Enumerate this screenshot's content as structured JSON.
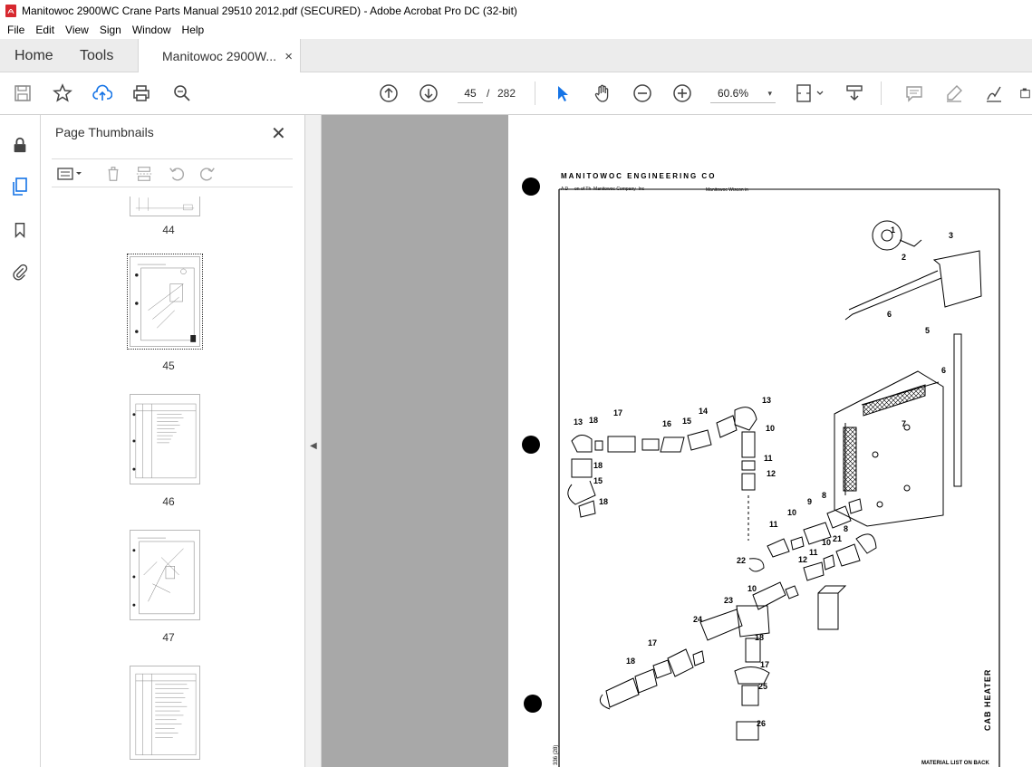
{
  "window": {
    "title": "Manitowoc 2900WC Crane Parts Manual 29510 2012.pdf (SECURED) - Adobe Acrobat Pro DC (32-bit)"
  },
  "menu": [
    "File",
    "Edit",
    "View",
    "Sign",
    "Window",
    "Help"
  ],
  "tabs": {
    "home": "Home",
    "tools": "Tools",
    "doc": "Manitowoc 2900W...",
    "close": "×"
  },
  "toolbar": {
    "page_current": "45",
    "page_sep": "/",
    "page_total": "282",
    "zoom": "60.6%",
    "zoom_caret": "▾"
  },
  "panel": {
    "title": "Page Thumbnails",
    "close": "✕",
    "thumbnails": [
      {
        "label": "44"
      },
      {
        "label": "45"
      },
      {
        "label": "46"
      },
      {
        "label": "47"
      },
      {
        "label": ""
      }
    ]
  },
  "document_page": {
    "header": "MANITOWOC ENGINEERING CO",
    "subheader_left": "A D     on of Th  Manitowoc Company  Inc",
    "subheader_right": "Manitowoc  Wiscon in",
    "side_title": "CAB HEATER",
    "footer": "MATERIAL LIST ON BACK",
    "side_code": "336 (28)",
    "callouts": [
      "1",
      "2",
      "3",
      "6",
      "5",
      "6",
      "7",
      "13",
      "17",
      "16",
      "15",
      "14",
      "13",
      "10",
      "11",
      "12",
      "18",
      "15",
      "18",
      "9",
      "8",
      "11",
      "10",
      "8",
      "21",
      "22",
      "12",
      "11",
      "10",
      "10",
      "23",
      "24",
      "18",
      "17",
      "18",
      "17",
      "25",
      "26"
    ]
  },
  "colors": {
    "accent_blue": "#1473e6",
    "viewer_bg": "#a8a8a8",
    "acrobat_red": "#d7282f"
  }
}
